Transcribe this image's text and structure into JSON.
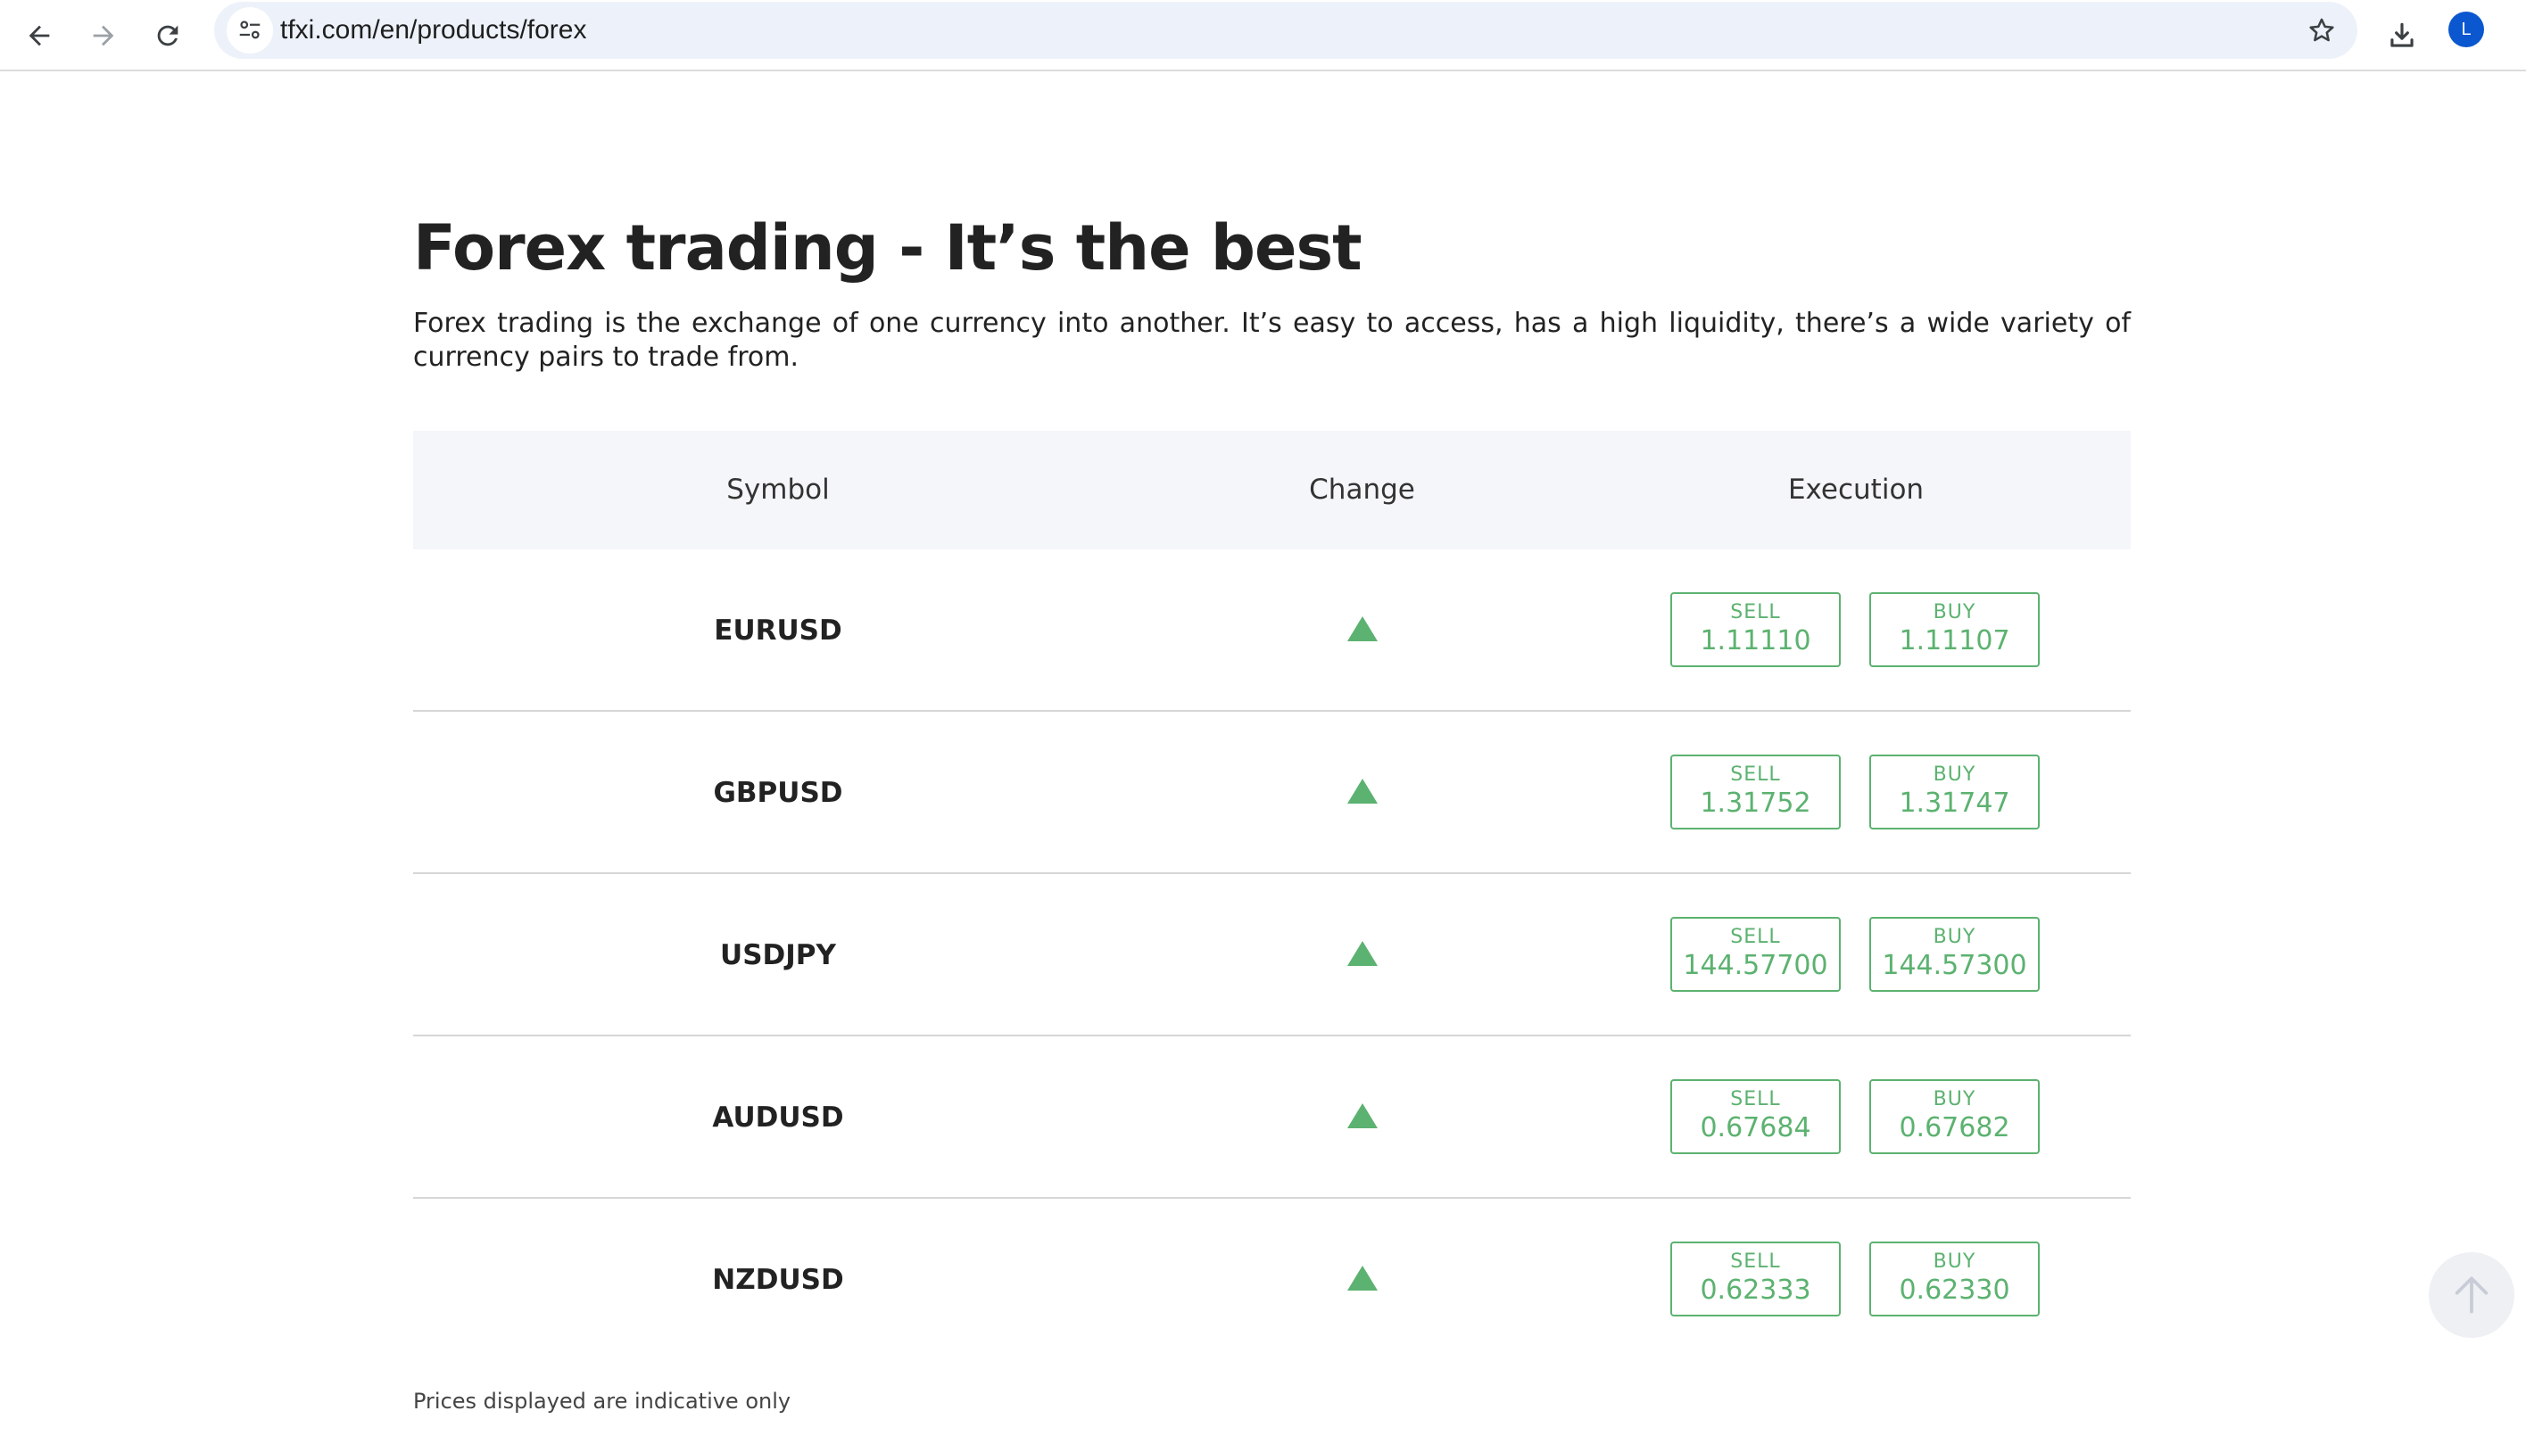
{
  "browser": {
    "url": "tfxi.com/en/products/forex",
    "avatar_letter": "L",
    "avatar_color": "#0b57d0",
    "icons": [
      "back-arrow-icon",
      "forward-arrow-icon",
      "reload-icon",
      "site-info-icon",
      "star-icon",
      "download-icon"
    ]
  },
  "page": {
    "title": "Forex trading - It’s the best",
    "intro": "Forex trading is the exchange of one currency into another. It’s easy to access, has a high liquidity, there’s a wide variety of currency pairs to trade from.",
    "disclaimer": "Prices displayed are indicative only"
  },
  "table": {
    "headers": {
      "symbol": "Symbol",
      "change": "Change",
      "execution": "Execution"
    },
    "rows": [
      {
        "symbol": "EURUSD",
        "change_icon": "triangle-up-icon",
        "sell_label": "SELL",
        "sell_price": "1.11110",
        "buy_label": "BUY",
        "buy_price": "1.11107"
      },
      {
        "symbol": "GBPUSD",
        "change_icon": "triangle-up-icon",
        "sell_label": "SELL",
        "sell_price": "1.31752",
        "buy_label": "BUY",
        "buy_price": "1.31747"
      },
      {
        "symbol": "USDJPY",
        "change_icon": "triangle-up-icon",
        "sell_label": "SELL",
        "sell_price": "144.57700",
        "buy_label": "BUY",
        "buy_price": "144.57300"
      },
      {
        "symbol": "AUDUSD",
        "change_icon": "triangle-up-icon",
        "sell_label": "SELL",
        "sell_price": "0.67684",
        "buy_label": "BUY",
        "buy_price": "0.67682"
      },
      {
        "symbol": "NZDUSD",
        "change_icon": "triangle-up-icon",
        "sell_label": "SELL",
        "sell_price": "0.62333",
        "buy_label": "BUY",
        "buy_price": "0.62330"
      }
    ]
  },
  "colors": {
    "accent_green": "#5cb270",
    "header_bg": "#f5f6f9",
    "text": "#222222"
  }
}
